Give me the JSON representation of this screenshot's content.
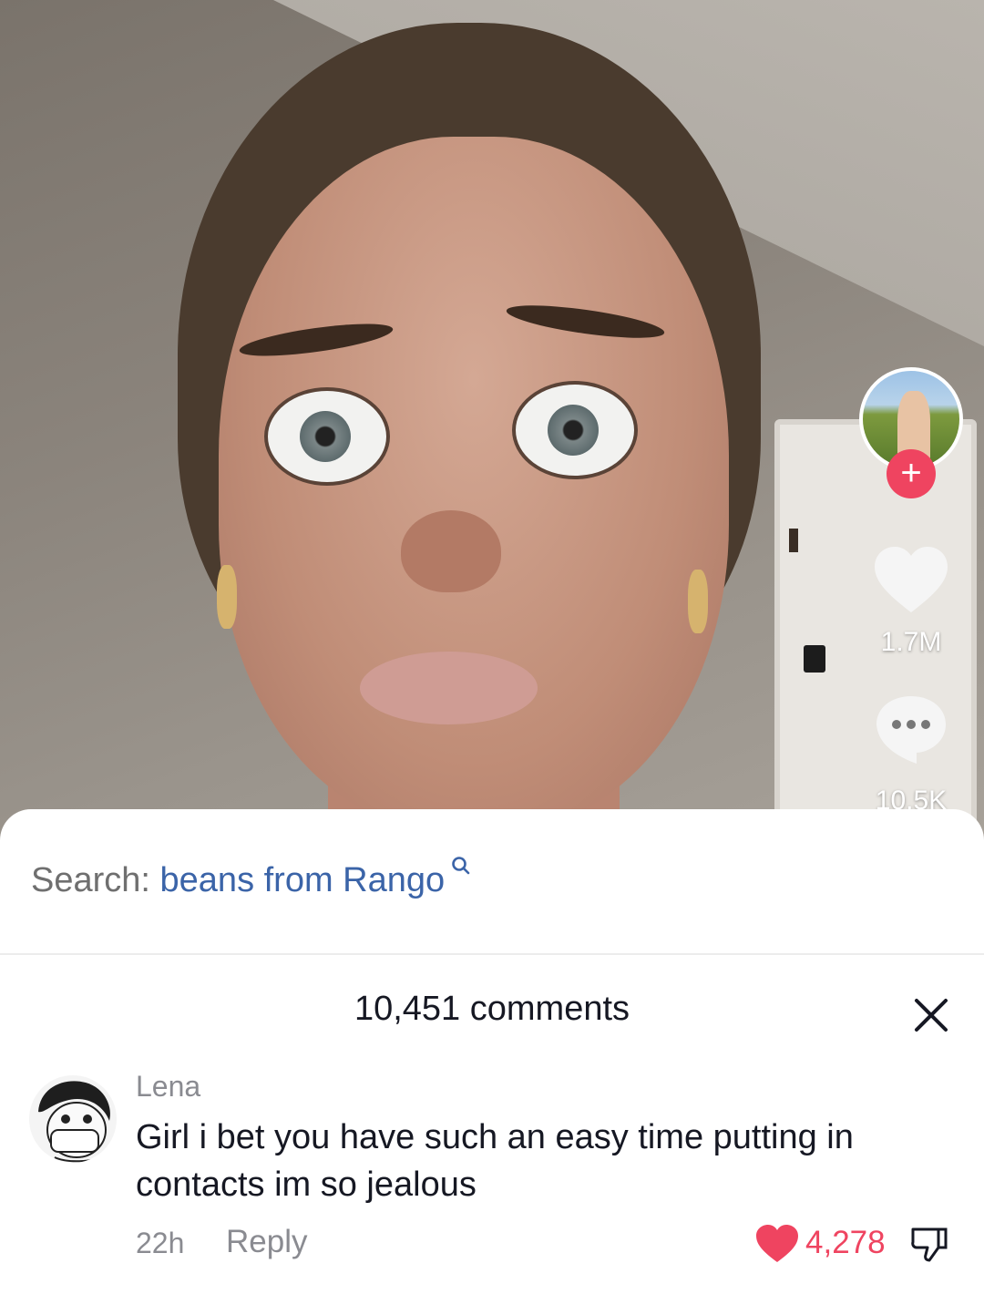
{
  "video": {
    "like_count": "1.7M",
    "comment_count": "10.5K",
    "follow_symbol": "+"
  },
  "search": {
    "prefix": "Search:",
    "term": "beans from Rango"
  },
  "comments": {
    "title": "10,451 comments",
    "items": [
      {
        "username": "Lena",
        "text": "Girl i bet you have such an easy time putting in contacts im so jealous",
        "time": "22h",
        "reply_label": "Reply",
        "likes": "4,278"
      }
    ]
  },
  "icons": {
    "like": "heart-icon",
    "comment": "comment-bubble-icon",
    "search": "search-icon",
    "close": "close-icon",
    "dislike": "thumbs-down-icon"
  },
  "colors": {
    "accent_red": "#ef4460",
    "search_blue": "#3b64a8"
  }
}
